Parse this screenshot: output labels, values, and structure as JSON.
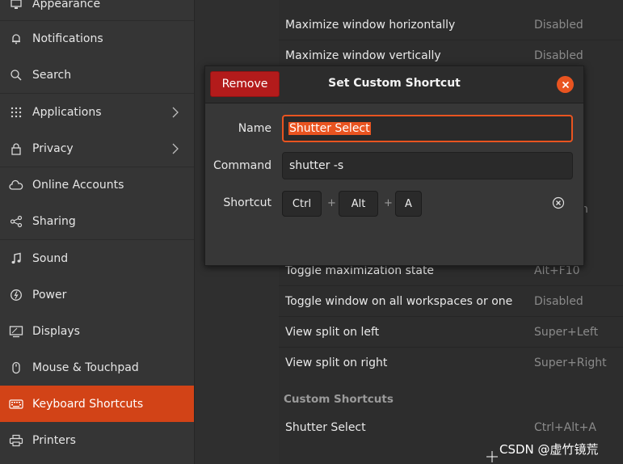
{
  "sidebar": {
    "items": [
      {
        "label": "Appearance",
        "icon": "appearance-icon"
      },
      {
        "label": "Notifications",
        "icon": "bell-icon"
      },
      {
        "label": "Search",
        "icon": "search-icon"
      },
      {
        "label": "Applications",
        "icon": "grid-icon"
      },
      {
        "label": "Privacy",
        "icon": "lock-icon"
      },
      {
        "label": "Online Accounts",
        "icon": "cloud-icon"
      },
      {
        "label": "Sharing",
        "icon": "share-icon"
      },
      {
        "label": "Sound",
        "icon": "music-note-icon"
      },
      {
        "label": "Power",
        "icon": "power-icon"
      },
      {
        "label": "Displays",
        "icon": "display-icon"
      },
      {
        "label": "Mouse & Touchpad",
        "icon": "mouse-icon"
      },
      {
        "label": "Keyboard Shortcuts",
        "icon": "keyboard-icon"
      },
      {
        "label": "Printers",
        "icon": "printer-icon"
      }
    ],
    "active": "Keyboard Shortcuts"
  },
  "shortcuts": {
    "rows": [
      {
        "name": "Maximize window horizontally",
        "accel": "Disabled"
      },
      {
        "name": "Maximize window vertically",
        "accel": "Disabled"
      },
      {
        "name": "Toggle maximization state",
        "accel": "Alt+F10"
      },
      {
        "name": "Toggle window on all workspaces or one",
        "accel": "Disabled"
      },
      {
        "name": "View split on left",
        "accel": "Super+Left"
      },
      {
        "name": "View split on right",
        "accel": "Super+Right"
      }
    ],
    "hidden_fragment": "own",
    "custom_section_title": "Custom Shortcuts",
    "custom_rows": [
      {
        "name": "Shutter Select",
        "accel": "Ctrl+Alt+A"
      }
    ]
  },
  "dialog": {
    "title": "Set Custom Shortcut",
    "remove_label": "Remove",
    "name_label": "Name",
    "name_value": "Shutter Select",
    "command_label": "Command",
    "command_value": "shutter -s",
    "shortcut_label": "Shortcut",
    "keys": [
      "Ctrl",
      "Alt",
      "A"
    ],
    "plus": "+"
  },
  "watermark": "CSDN @虚竹镜荒",
  "colors": {
    "accent": "#e95420",
    "remove": "#b31b1b",
    "active_sidebar": "#d24317"
  }
}
